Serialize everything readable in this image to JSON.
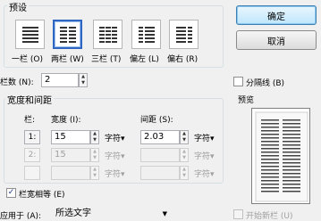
{
  "presets": {
    "title": "预设",
    "items": [
      {
        "label": "一栏 (O)",
        "icon": "one-column-icon"
      },
      {
        "label": "两栏 (W)",
        "icon": "two-column-icon"
      },
      {
        "label": "三栏 (T)",
        "icon": "three-column-icon"
      },
      {
        "label": "偏左 (L)",
        "icon": "left-column-icon"
      },
      {
        "label": "偏右 (R)",
        "icon": "right-column-icon"
      }
    ],
    "selected_index": 1
  },
  "buttons": {
    "ok": "确定",
    "cancel": "取消"
  },
  "column_count": {
    "label": "栏数 (N):",
    "value": "2"
  },
  "separator": {
    "label": "分隔线 (B)",
    "checked": false
  },
  "width_spacing": {
    "title": "宽度和间距",
    "col_header": "栏:",
    "width_header": "宽度 (I):",
    "spacing_header": "间距 (S):",
    "rows": [
      {
        "index": "1:",
        "width": "15",
        "width_unit": "字符▾",
        "spacing": "2.03",
        "spacing_unit": "字符▾",
        "enabled": true
      },
      {
        "index": "2:",
        "width": "15",
        "width_unit": "字符▾",
        "spacing": "",
        "spacing_unit": "字符▾",
        "enabled": false
      },
      {
        "index": "",
        "width": "",
        "width_unit": "字符▾",
        "spacing": "",
        "spacing_unit": "字符▾",
        "enabled": false
      }
    ]
  },
  "equal_width": {
    "label": "栏宽相等 (E)",
    "checked": true
  },
  "preview": {
    "title": "预览"
  },
  "apply_to": {
    "label": "应用于 (A):",
    "value": "所选文字"
  },
  "new_column": {
    "label": "开始新栏 (U)",
    "checked": false
  },
  "colors": {
    "accent": "#2f66c2",
    "check": "#1b3a84"
  }
}
